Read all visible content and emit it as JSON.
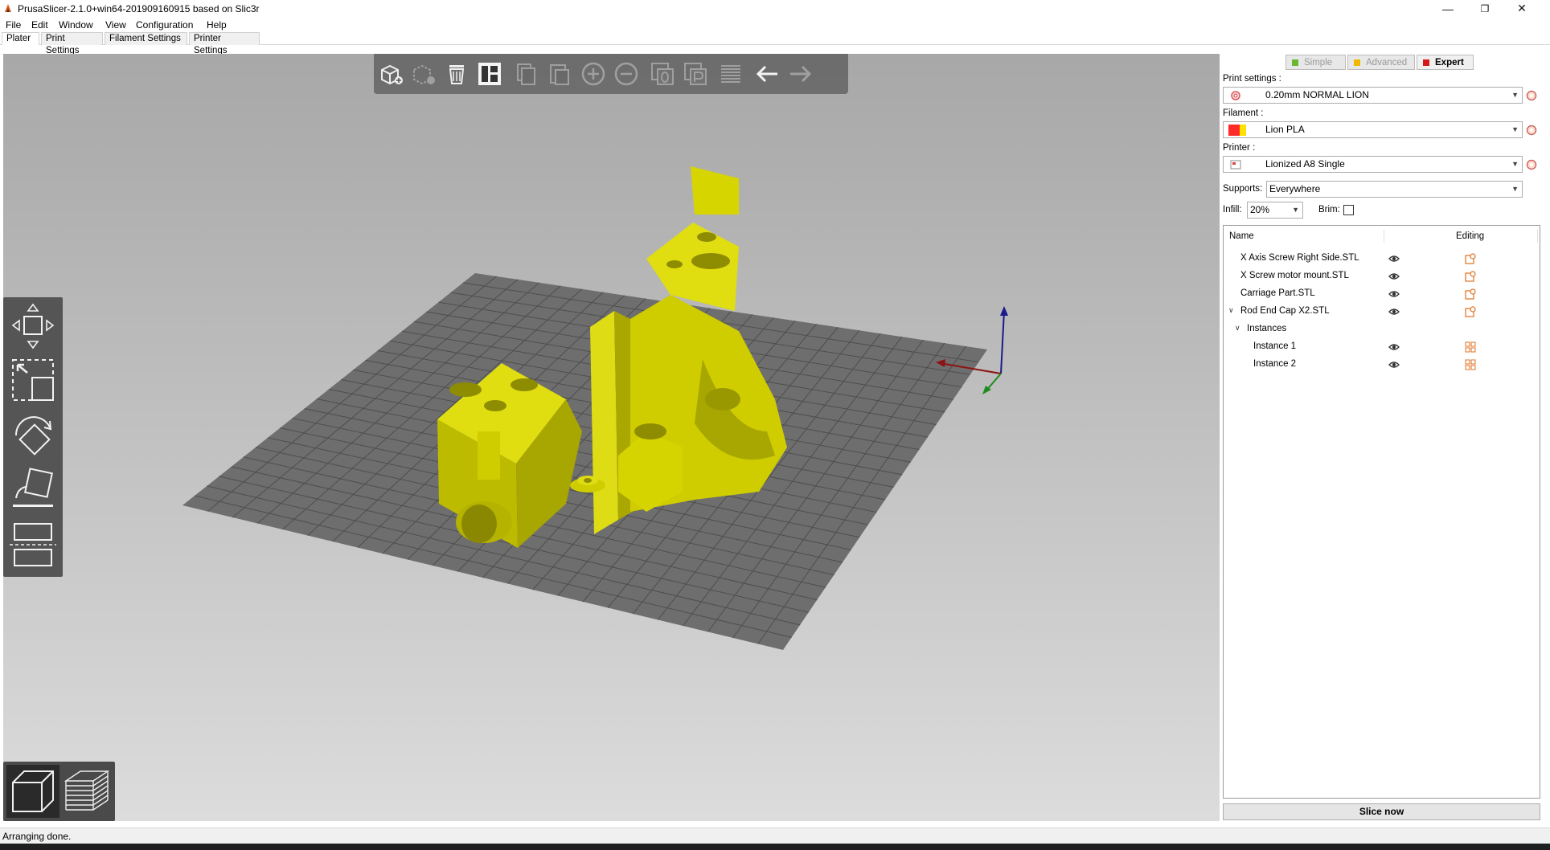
{
  "window": {
    "title": "PrusaSlicer-2.1.0+win64-201909160915 based on Slic3r",
    "minimize": "—",
    "maximize": "❐",
    "close": "✕"
  },
  "menu": [
    "File",
    "Edit",
    "Window",
    "View",
    "Configuration",
    "Help"
  ],
  "tabs": [
    "Plater",
    "Print Settings",
    "Filament Settings",
    "Printer Settings"
  ],
  "toolbar": [
    "add-icon",
    "delete-icon",
    "delete-all-icon",
    "arrange-icon",
    "copy-icon",
    "paste-icon",
    "add-instance-icon",
    "remove-instance-icon",
    "split-objects-icon",
    "split-parts-icon",
    "layers-editing-icon",
    "undo-icon",
    "redo-icon"
  ],
  "modes": {
    "simple": {
      "label": "Simple",
      "color": "#6ab82e"
    },
    "advanced": {
      "label": "Advanced",
      "color": "#f0b800"
    },
    "expert": {
      "label": "Expert",
      "color": "#d81818"
    }
  },
  "print_settings": {
    "label": "Print settings :",
    "value": "0.20mm NORMAL LION"
  },
  "filament": {
    "label": "Filament :",
    "value": "Lion PLA",
    "colors": [
      "#ff2a2a",
      "#ffe000"
    ]
  },
  "printer": {
    "label": "Printer :",
    "value": "Lionized A8 Single"
  },
  "supports": {
    "label": "Supports:",
    "value": "Everywhere"
  },
  "infill": {
    "label": "Infill:",
    "value": "20%"
  },
  "brim": {
    "label": "Brim:",
    "checked": false
  },
  "object_list": {
    "headers": {
      "name": "Name",
      "editing": "Editing"
    },
    "items": [
      {
        "name": "X Axis Screw Right Side.STL",
        "level": 0
      },
      {
        "name": "X Screw motor mount.STL",
        "level": 0
      },
      {
        "name": "Carriage Part.STL",
        "level": 0
      },
      {
        "name": "Rod End Cap X2.STL",
        "level": 0,
        "expanded": true
      },
      {
        "name": "Instances",
        "level": 1,
        "expanded": true
      },
      {
        "name": "Instance 1",
        "level": 2
      },
      {
        "name": "Instance 2",
        "level": 2
      }
    ]
  },
  "slice_button": "Slice now",
  "status": "Arranging done.",
  "colors": {
    "model": "#d2d000",
    "bed": "#6e6e6e",
    "bed_grid": "#4a4a4a"
  }
}
